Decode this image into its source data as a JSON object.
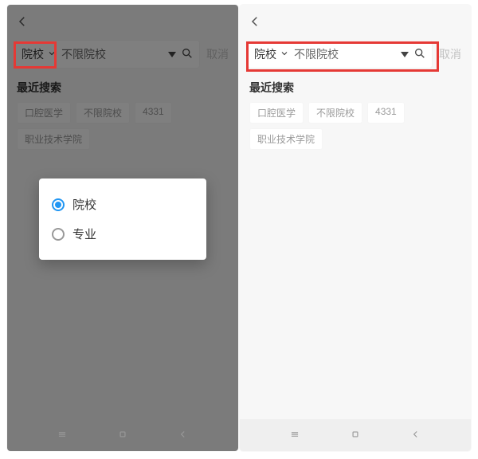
{
  "common": {
    "category_label": "院校",
    "search_placeholder": "不限院校",
    "cancel_label": "取消",
    "recent_title": "最近搜索",
    "recent_chips": [
      "口腔医学",
      "不限院校",
      "4331",
      "职业技术学院"
    ]
  },
  "popup": {
    "options": [
      {
        "label": "院校",
        "selected": true
      },
      {
        "label": "专业",
        "selected": false
      }
    ]
  }
}
